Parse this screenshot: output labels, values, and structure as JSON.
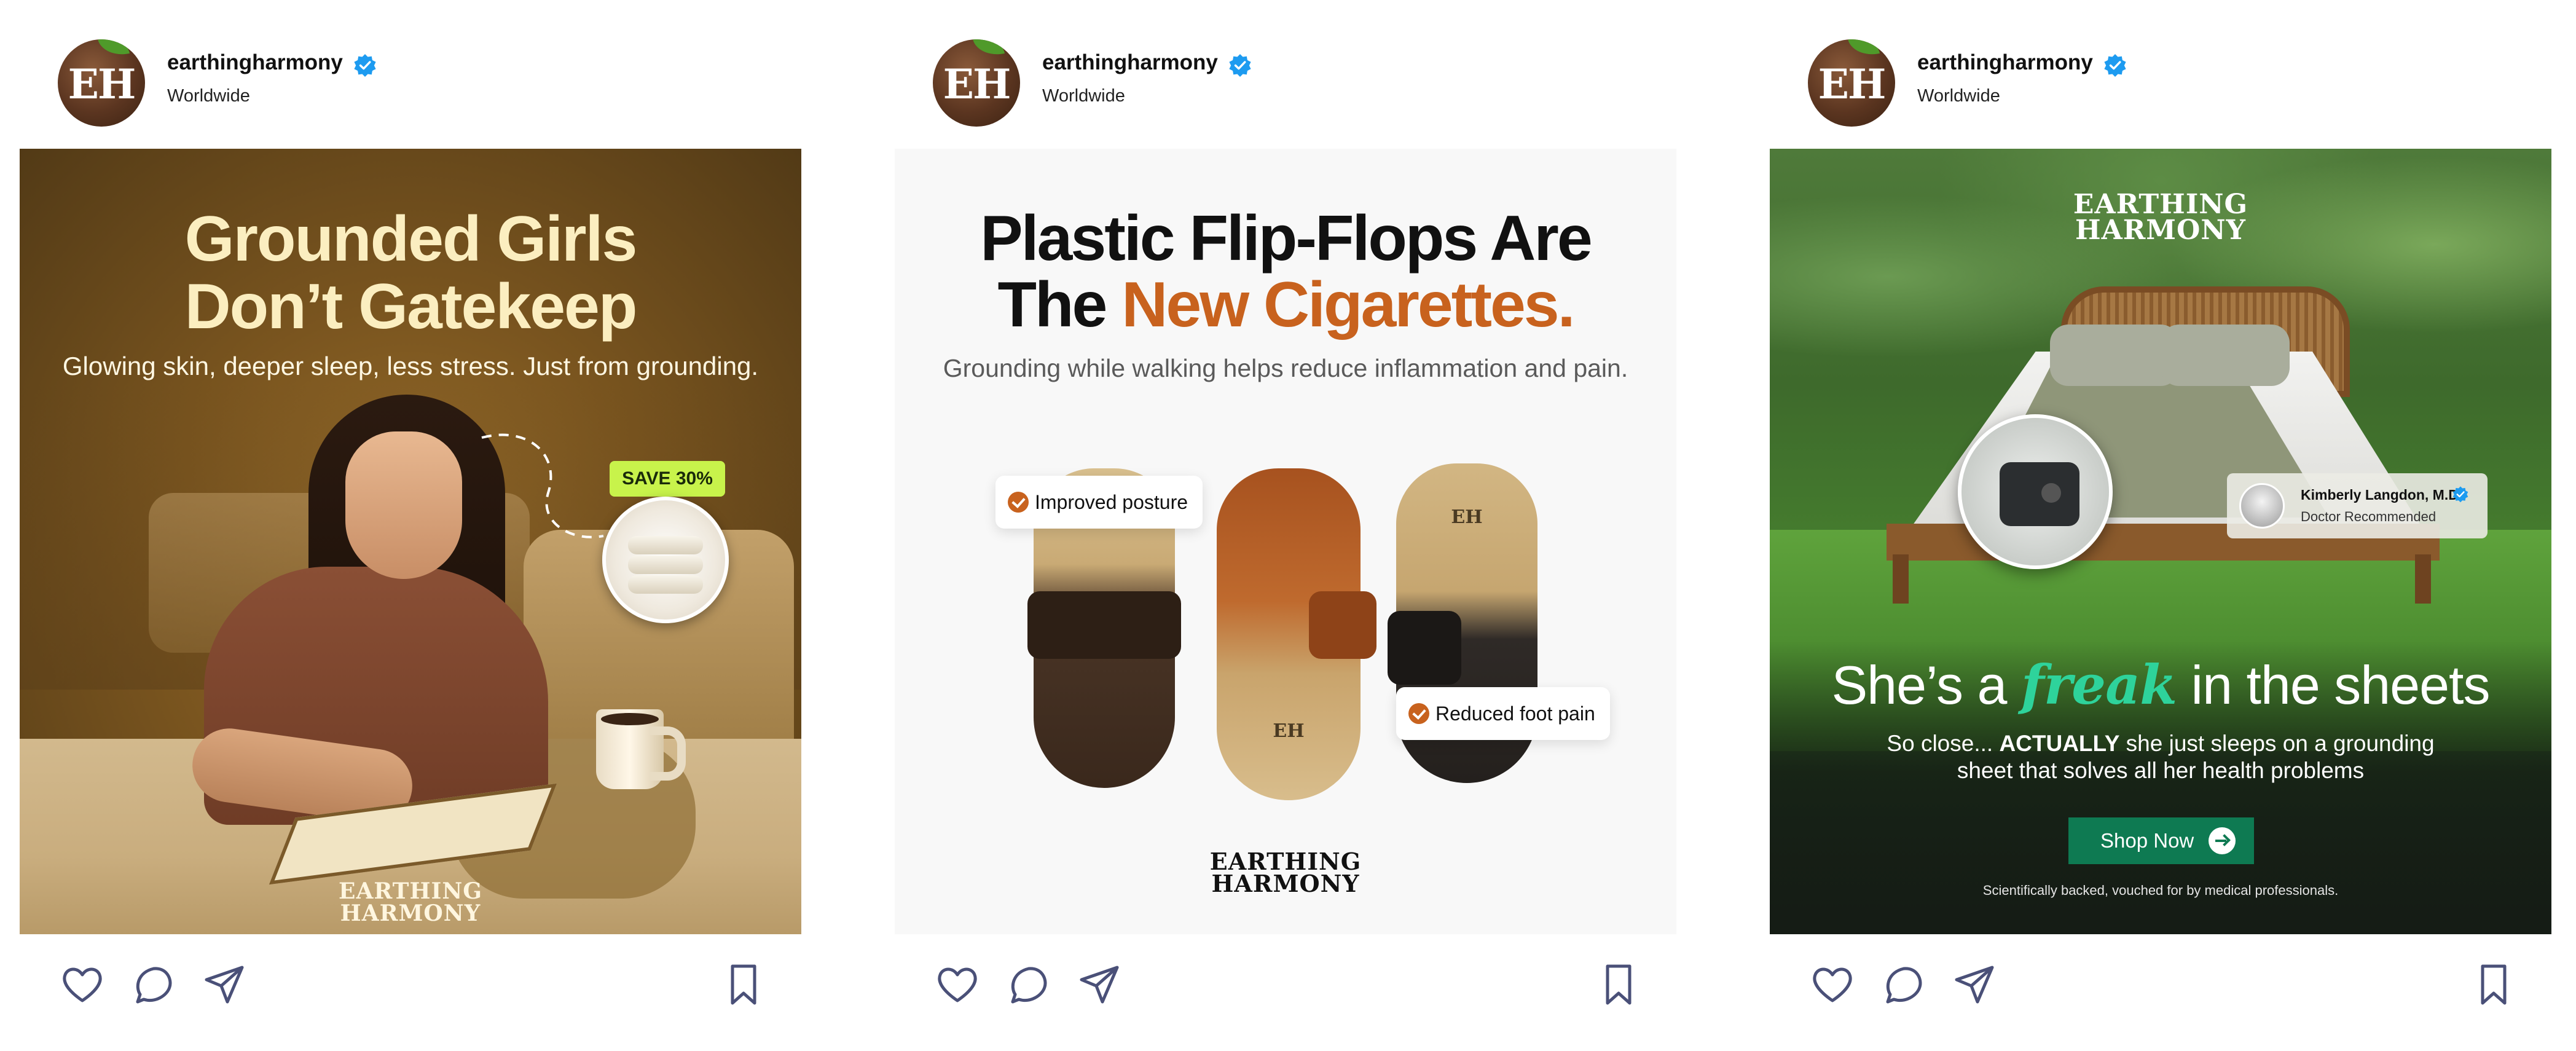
{
  "colors": {
    "icon_stroke": "#4a5078",
    "verified_blue": "#1d9bf0",
    "c1_title": "#fbeec0",
    "c1_save_badge": "#c8f34b",
    "c2_accent": "#c8621e",
    "c3_accent": "#2ed39b",
    "c3_button": "#0e7a52"
  },
  "posts": [
    {
      "account": {
        "avatar_monogram": "EH",
        "username": "earthingharmony",
        "location": "Worldwide",
        "verified_icon": "verified-badge-icon"
      },
      "creative": {
        "title_line1": "Grounded Girls",
        "title_line2": "Don’t Gatekeep",
        "subtitle": "Glowing skin, deeper sleep, less stress. Just from grounding.",
        "badge": "SAVE 30%",
        "brand_line1": "EARTHING",
        "brand_line2": "HARMONY"
      },
      "actions": [
        "heart-icon",
        "comment-icon",
        "share-icon",
        "bookmark-icon"
      ]
    },
    {
      "account": {
        "avatar_monogram": "EH",
        "username": "earthingharmony",
        "location": "Worldwide",
        "verified_icon": "verified-badge-icon"
      },
      "creative": {
        "title_line1": "Plastic Flip-Flops Are",
        "title_line2_plain": "The ",
        "title_line2_accent": "New Cigarettes.",
        "subtitle": "Grounding while walking helps reduce inflammation and pain.",
        "chip1": "Improved posture",
        "chip2": "Reduced foot pain",
        "shoe_logo": "EH",
        "brand_line1": "EARTHING",
        "brand_line2": "HARMONY"
      },
      "actions": [
        "heart-icon",
        "comment-icon",
        "share-icon",
        "bookmark-icon"
      ]
    },
    {
      "account": {
        "avatar_monogram": "EH",
        "username": "earthingharmony",
        "location": "Worldwide",
        "verified_icon": "verified-badge-icon"
      },
      "creative": {
        "brand_line1": "EARTHING",
        "brand_line2": "HARMONY",
        "doctor_name": "Kimberly Langdon, M.D.",
        "doctor_title": "Doctor Recommended",
        "headline_pre": "She’s a ",
        "headline_accent": "freak",
        "headline_post": " in the sheets",
        "sub_line1_pre": "So close... ",
        "sub_line1_bold": "ACTUALLY",
        "sub_line1_post": " she just sleeps on a grounding",
        "sub_line2": "sheet that solves all her health problems",
        "button": "Shop Now",
        "fine_print": "Scientifically backed, vouched for by medical professionals."
      },
      "actions": [
        "heart-icon",
        "comment-icon",
        "share-icon",
        "bookmark-icon"
      ]
    }
  ]
}
